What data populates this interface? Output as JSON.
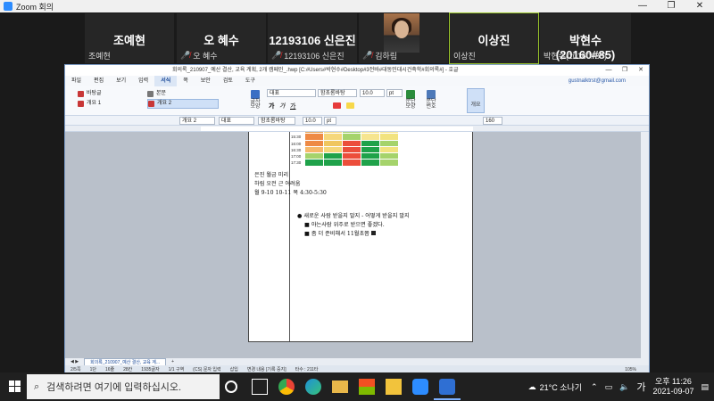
{
  "zoom": {
    "title": "Zoom 회의",
    "controls": [
      "—",
      "❐",
      "✕"
    ],
    "participants": [
      {
        "big": "조예현",
        "small": "조예현",
        "muted": false
      },
      {
        "big": "오 혜수",
        "small": "오 혜수",
        "muted": true
      },
      {
        "big": "12193106 신은진",
        "small": "12193106 신은진",
        "muted": true
      },
      {
        "big": "",
        "small": "김하림",
        "muted": true,
        "has_photo": true
      },
      {
        "big": "이상진",
        "small": "이상진",
        "muted": false,
        "active": true
      },
      {
        "big": "박현수(20160#85)",
        "small": "박현수(20160#85)",
        "muted": false
      }
    ]
  },
  "hwp": {
    "title": "회의록_210907_예산 결산, 교육 계획, 2개 캠페인_.hwp [C:#Users#박현수#Desktop#3전바#대동민대시건축학#회의록#] - 호글",
    "menu": [
      "파일",
      "편집",
      "보기",
      "입력",
      "서식",
      "쪽",
      "보안",
      "검토",
      "도구"
    ],
    "menu_selected": "서식",
    "account": "gustnalktrst@gmail.com",
    "styles": [
      "바탕글",
      "본문",
      "개요 1",
      "개요 2"
    ],
    "style_selected": "개요 2",
    "ribbon": {
      "font_name": "대표",
      "font_face": "함초롬바탕",
      "font_size": "10.0",
      "unit": "pt",
      "char_shape_label": "글자\n모양",
      "para_shape_label": "문단\n모양",
      "para_number_label": "문단\n번호",
      "outline_label": "개요",
      "zoom": "160",
      "zoom_unit": "%"
    },
    "toolbar2": {
      "style": "개요 2",
      "font_name": "대표",
      "font_face": "함초롬바탕",
      "font_size": "10.0",
      "unit": "pt",
      "zoom": "160"
    },
    "schedule": {
      "times": [
        "15:00",
        "15:30",
        "16:00",
        "16:30",
        "17:00",
        "17:30"
      ],
      "rows": [
        [
          "#e8a24f",
          "#f5d77a",
          "#a5d36b",
          "#f6e58f",
          "#f6e58f"
        ],
        [
          "#ee8a45",
          "#f5d77a",
          "#a5d36b",
          "#f6e58f",
          "#f2e37f"
        ],
        [
          "#ee8a45",
          "#f0c65f",
          "#ec4e3b",
          "#1fa24a",
          "#a5d36b"
        ],
        [
          "#f6b86a",
          "#f5d77a",
          "#ec4e3b",
          "#1fa24a",
          "#f2e37f"
        ],
        [
          "#a5d36b",
          "#1fa24a",
          "#ec4e3b",
          "#1fa24a",
          "#a5d36b"
        ],
        [
          "#1fa24a",
          "#1fa24a",
          "#ec4e3b",
          "#1fa24a",
          "#a5d36b"
        ]
      ]
    },
    "doc_lines": [
      "은진 월금 미리",
      "하림 오전 근 어려움",
      "월 9-10 10-11 목 4:30-5:30"
    ],
    "bullets": {
      "main": "새로운 사람 받을지 말지 - 어떻게 받을지 말지",
      "sub": [
        "아는사람 위주로 받으면 좋겠다.",
        "좀 더 준비해서 11월초쯤"
      ]
    },
    "doc_tab": "회의록_210907_예산 결산, 교육 계...",
    "status": [
      "2/5쪽",
      "1단",
      "16줄",
      "28칸",
      "1935글자",
      "1/1 구역",
      "(CS) 문자 입력",
      "삽입",
      "변경 내용 [기록 중지]",
      "타수 : 211타"
    ],
    "status_zoom": "105%"
  },
  "taskbar": {
    "search_placeholder": "검색하려면 여기에 입력하십시오.",
    "weather": "21°C 소나기",
    "ime": "가",
    "time": "오후 11:26",
    "date": "2021-09-07"
  }
}
